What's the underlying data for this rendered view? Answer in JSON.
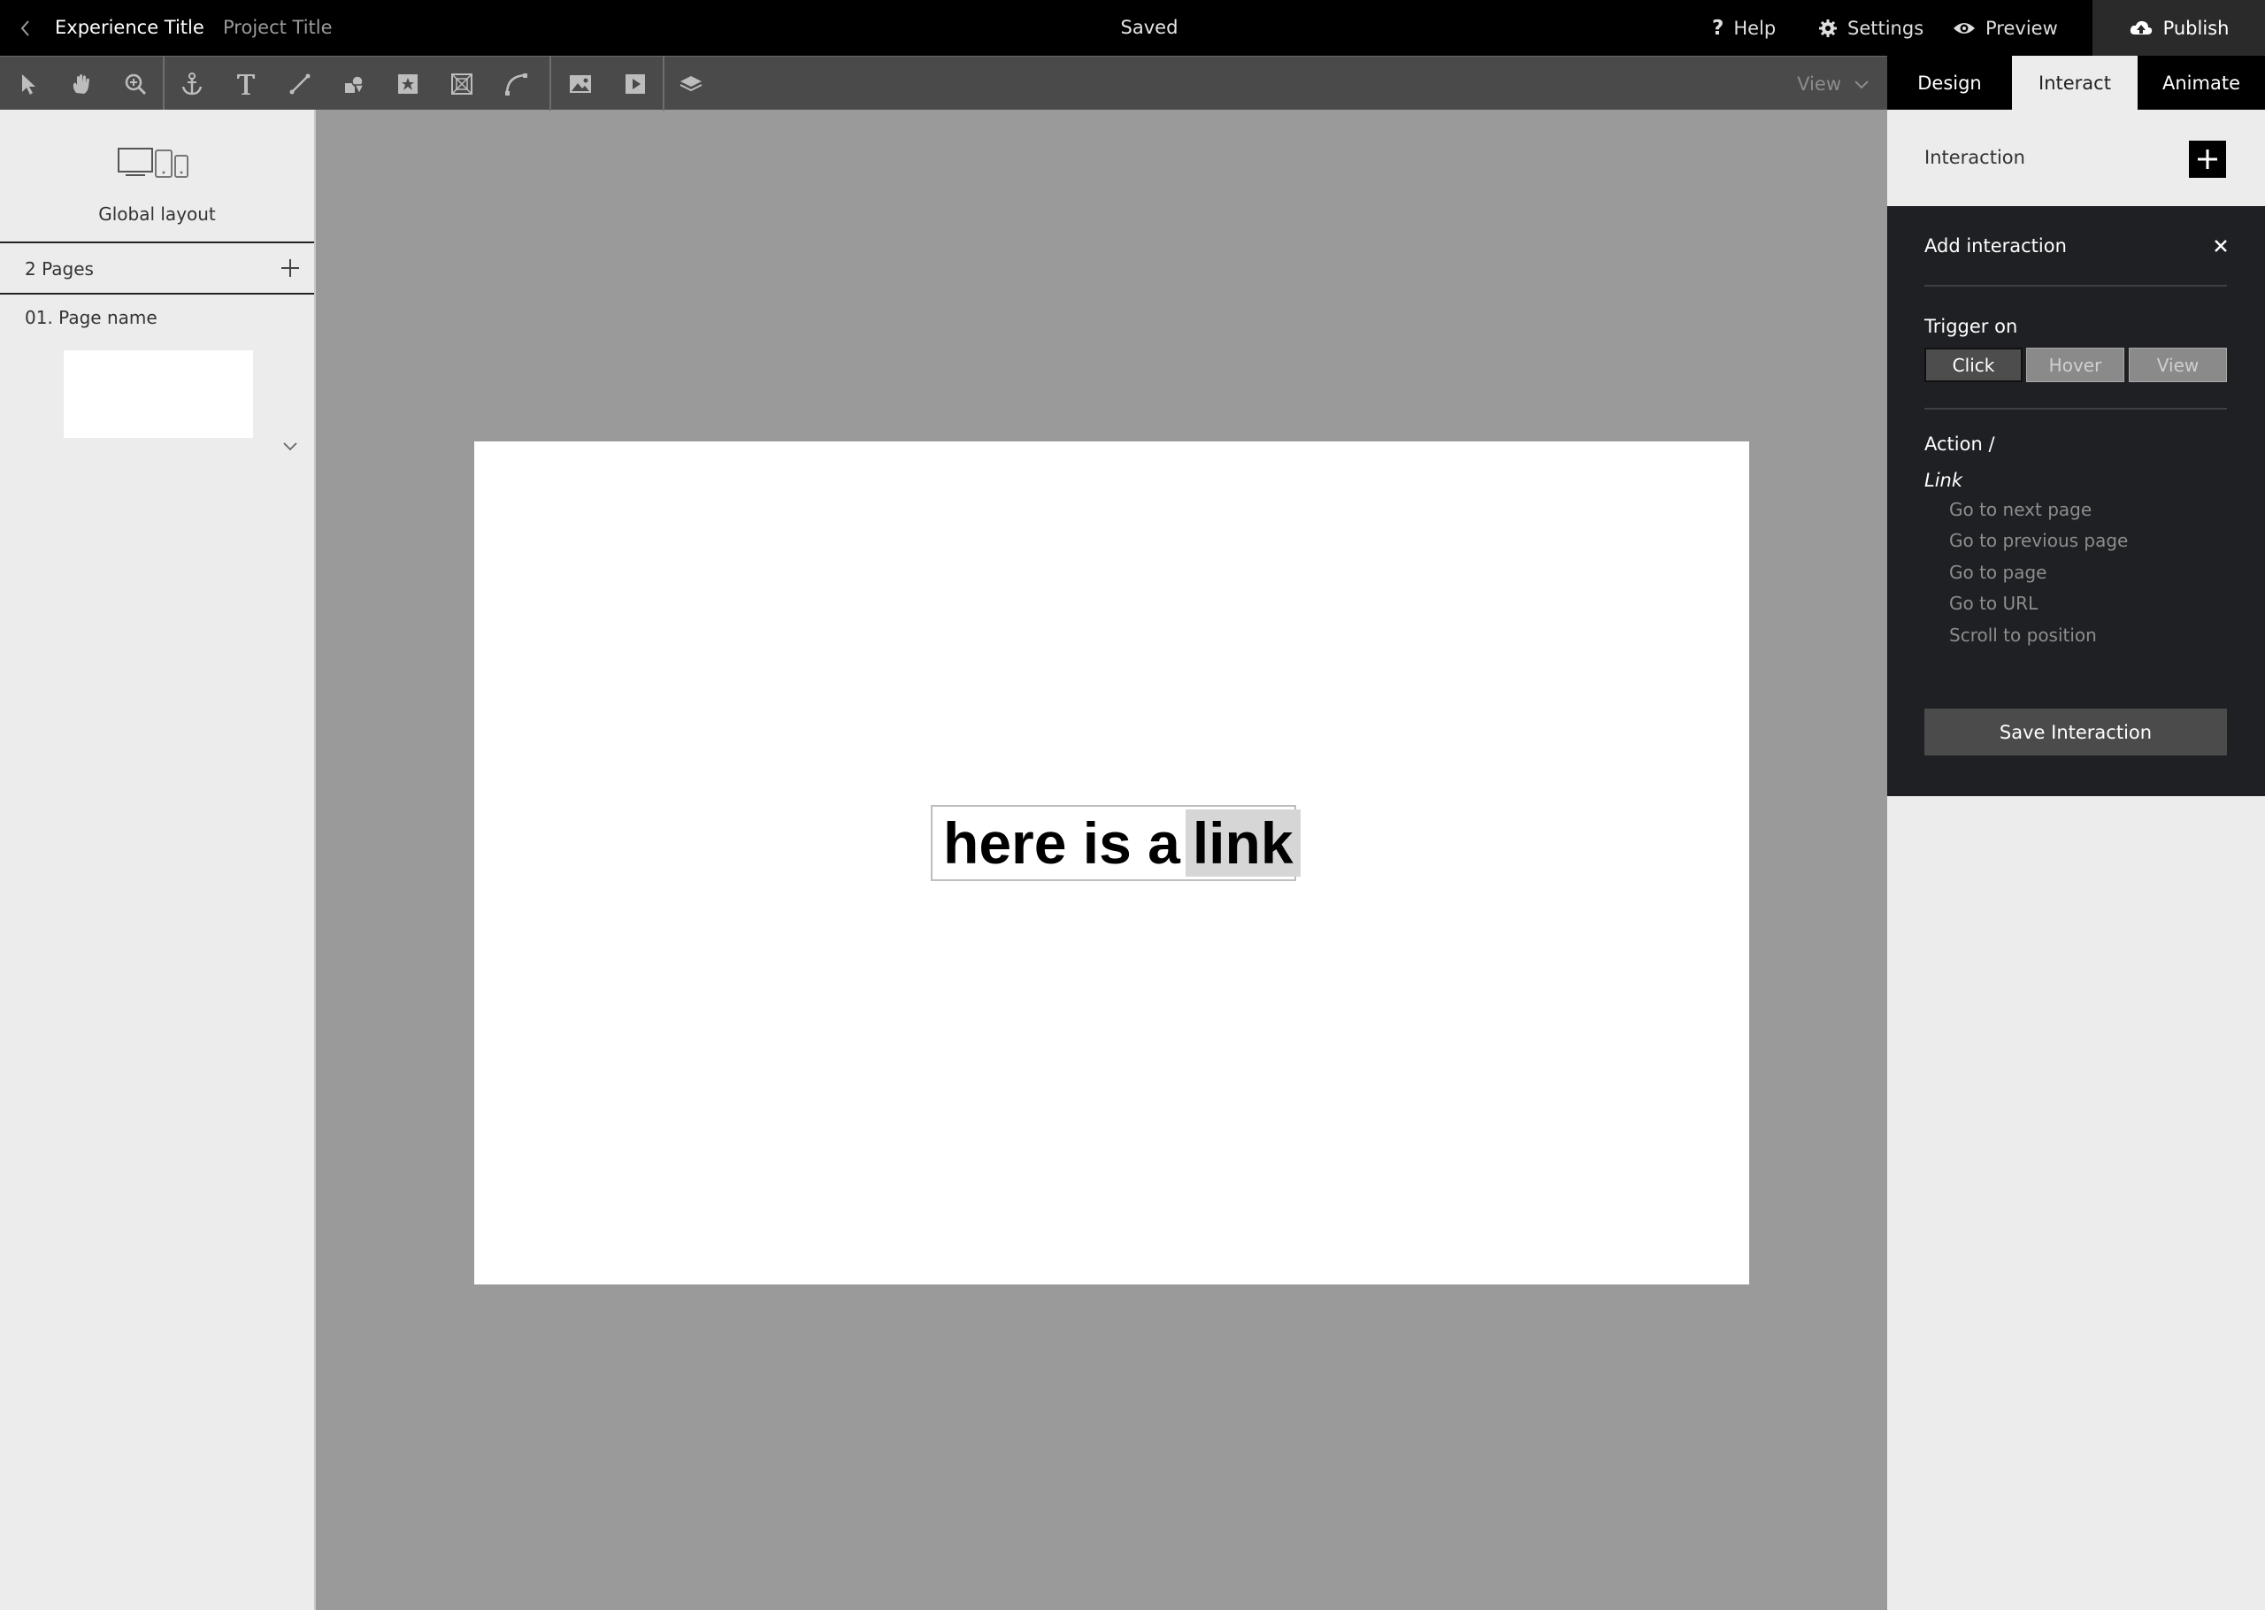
{
  "topbar": {
    "experience_title": "Experience Title",
    "project_title": "Project Title",
    "status": "Saved",
    "help_label": "Help",
    "settings_label": "Settings",
    "preview_label": "Preview",
    "publish_label": "Publish"
  },
  "toolbar": {
    "tools": [
      "pointer-icon",
      "hand-icon",
      "zoom-icon",
      "anchor-icon",
      "text-icon",
      "line-icon",
      "shapes-icon",
      "star-box-icon",
      "frame-icon",
      "curve-icon",
      "image-icon",
      "video-icon",
      "layers-icon"
    ],
    "view_label": "View"
  },
  "right_tabs": [
    "Design",
    "Interact",
    "Animate"
  ],
  "right_tabs_active": "Interact",
  "sidebar": {
    "global_layout_label": "Global layout",
    "pages_count_label": "2 Pages",
    "page_name": "01. Page name"
  },
  "canvas": {
    "text_plain": "here is a",
    "text_link": "link"
  },
  "interaction_panel": {
    "header": "Interaction",
    "add_title": "Add interaction",
    "trigger_label": "Trigger on",
    "trigger_options": [
      "Click",
      "Hover",
      "View"
    ],
    "trigger_selected": "Click",
    "action_label": "Action /",
    "link_group": "Link",
    "link_options": [
      "Go to next page",
      "Go to previous page",
      "Go to page",
      "Go to URL",
      "Scroll to position"
    ],
    "save_label": "Save Interaction"
  },
  "colors": {
    "topbar_bg": "#000000",
    "toolbar_bg": "#4a4a4a",
    "workspace_bg": "#9a9a9a",
    "panel_dark": "#1e2024",
    "panel_light": "#ececec",
    "link_highlight": "#d6d6d6"
  }
}
